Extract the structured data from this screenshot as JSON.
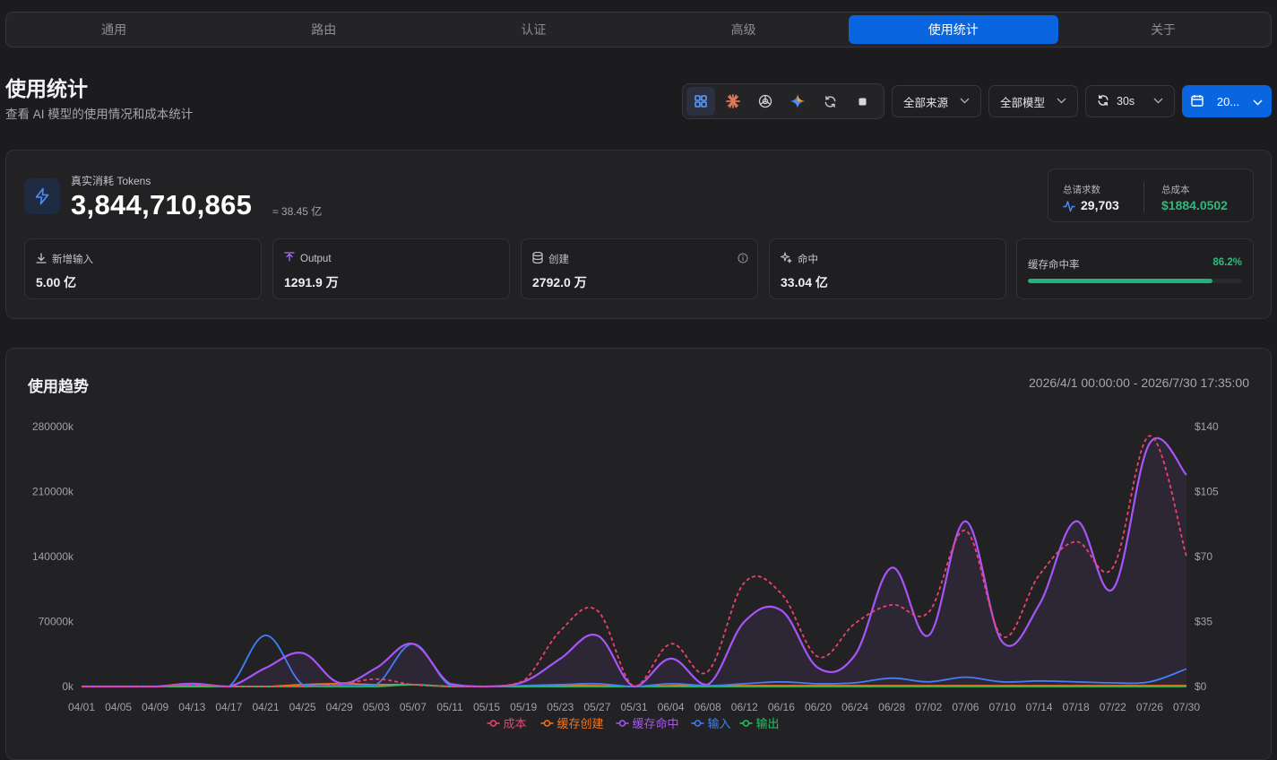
{
  "tabs": [
    "通用",
    "路由",
    "认证",
    "高级",
    "使用统计",
    "关于"
  ],
  "active_tab": 4,
  "page": {
    "title": "使用统计",
    "subtitle": "查看 AI 模型的使用情况和成本统计"
  },
  "toolbar": {
    "icons": [
      "grid-icon",
      "claude-icon",
      "openai-icon",
      "gemini-icon",
      "refresh-provider-icon",
      "square-icon"
    ],
    "source_select": "全部来源",
    "model_select": "全部模型",
    "refresh_interval": "30s",
    "date_button": "20..."
  },
  "tokens": {
    "label": "真实消耗 Tokens",
    "value": "3,844,710,865",
    "approx": "≈ 38.45 亿"
  },
  "summary": {
    "requests_label": "总请求数",
    "requests_value": "29,703",
    "cost_label": "总成本",
    "cost_value": "$1884.0502"
  },
  "stats": [
    {
      "label": "新增输入",
      "value": "5.00 亿",
      "icon": "download-icon"
    },
    {
      "label": "Output",
      "value": "1291.9 万",
      "icon": "upload-icon"
    },
    {
      "label": "创建",
      "value": "2792.0 万",
      "icon": "database-icon"
    },
    {
      "label": "命中",
      "value": "33.04 亿",
      "icon": "sparkles-icon"
    }
  ],
  "cache_hit": {
    "label": "缓存命中率",
    "value": "86.2%",
    "fraction": 0.862
  },
  "trend": {
    "title": "使用趋势",
    "range": "2026/4/1 00:00:00 - 2026/7/30 17:35:00"
  },
  "colors": {
    "cost": "#f0416c",
    "cache_create": "#f97316",
    "cache_hit": "#a855f7",
    "input": "#3b82f6",
    "output": "#22c55e",
    "accent": "#0a66e0"
  },
  "chart_data": {
    "type": "line",
    "x": [
      "04/01",
      "04/05",
      "04/09",
      "04/13",
      "04/17",
      "04/21",
      "04/25",
      "04/29",
      "05/03",
      "05/07",
      "05/11",
      "05/15",
      "05/19",
      "05/23",
      "05/27",
      "05/31",
      "06/04",
      "06/08",
      "06/12",
      "06/16",
      "06/20",
      "06/24",
      "06/28",
      "07/02",
      "07/06",
      "07/10",
      "07/14",
      "07/18",
      "07/22",
      "07/26",
      "07/30"
    ],
    "y_left": {
      "ticks": [
        "0k",
        "70000k",
        "140000k",
        "210000k",
        "280000k"
      ],
      "range": [
        0,
        280000
      ]
    },
    "y_right": {
      "ticks": [
        "$0",
        "$35",
        "$70",
        "$105",
        "$140"
      ],
      "range": [
        0,
        140
      ]
    },
    "series": [
      {
        "name": "成本",
        "axis": "right",
        "style": "dashed",
        "values": [
          0,
          0,
          0,
          1,
          0,
          0,
          0,
          1,
          4,
          1,
          0,
          0,
          3,
          30,
          41,
          0,
          23,
          8,
          56,
          50,
          16,
          34,
          44,
          40,
          84,
          27,
          60,
          78,
          64,
          135,
          70
        ]
      },
      {
        "name": "缓存创建",
        "axis": "left",
        "values": [
          0,
          0,
          0,
          0,
          0,
          0,
          2000,
          3000,
          2000,
          2000,
          0,
          0,
          0,
          1000,
          1000,
          0,
          1000,
          1000,
          1000,
          1000,
          1000,
          1000,
          1000,
          1000,
          1000,
          1000,
          1000,
          1000,
          1000,
          1000,
          1000
        ]
      },
      {
        "name": "缓存命中",
        "axis": "left",
        "values": [
          0,
          0,
          0,
          3000,
          0,
          20000,
          36000,
          4000,
          20000,
          46000,
          3000,
          0,
          5000,
          30000,
          55000,
          0,
          30000,
          2000,
          70000,
          82000,
          20000,
          34000,
          128000,
          55000,
          178000,
          48000,
          88000,
          178000,
          105000,
          262000,
          228000
        ]
      },
      {
        "name": "输入",
        "axis": "left",
        "values": [
          0,
          0,
          0,
          2000,
          0,
          55000,
          2000,
          1000,
          2000,
          46000,
          1000,
          0,
          1000,
          2000,
          3000,
          0,
          3000,
          1000,
          3000,
          5000,
          3000,
          4000,
          9000,
          5000,
          10000,
          5000,
          6000,
          5000,
          4000,
          5000,
          19000
        ]
      },
      {
        "name": "输出",
        "axis": "left",
        "values": [
          0,
          0,
          0,
          0,
          0,
          0,
          0,
          0,
          0,
          2000,
          0,
          0,
          0,
          0,
          0,
          0,
          0,
          0,
          0,
          0,
          0,
          0,
          0,
          0,
          0,
          0,
          0,
          0,
          0,
          0,
          0
        ]
      }
    ],
    "legend": "bottom-center",
    "grid": false
  }
}
